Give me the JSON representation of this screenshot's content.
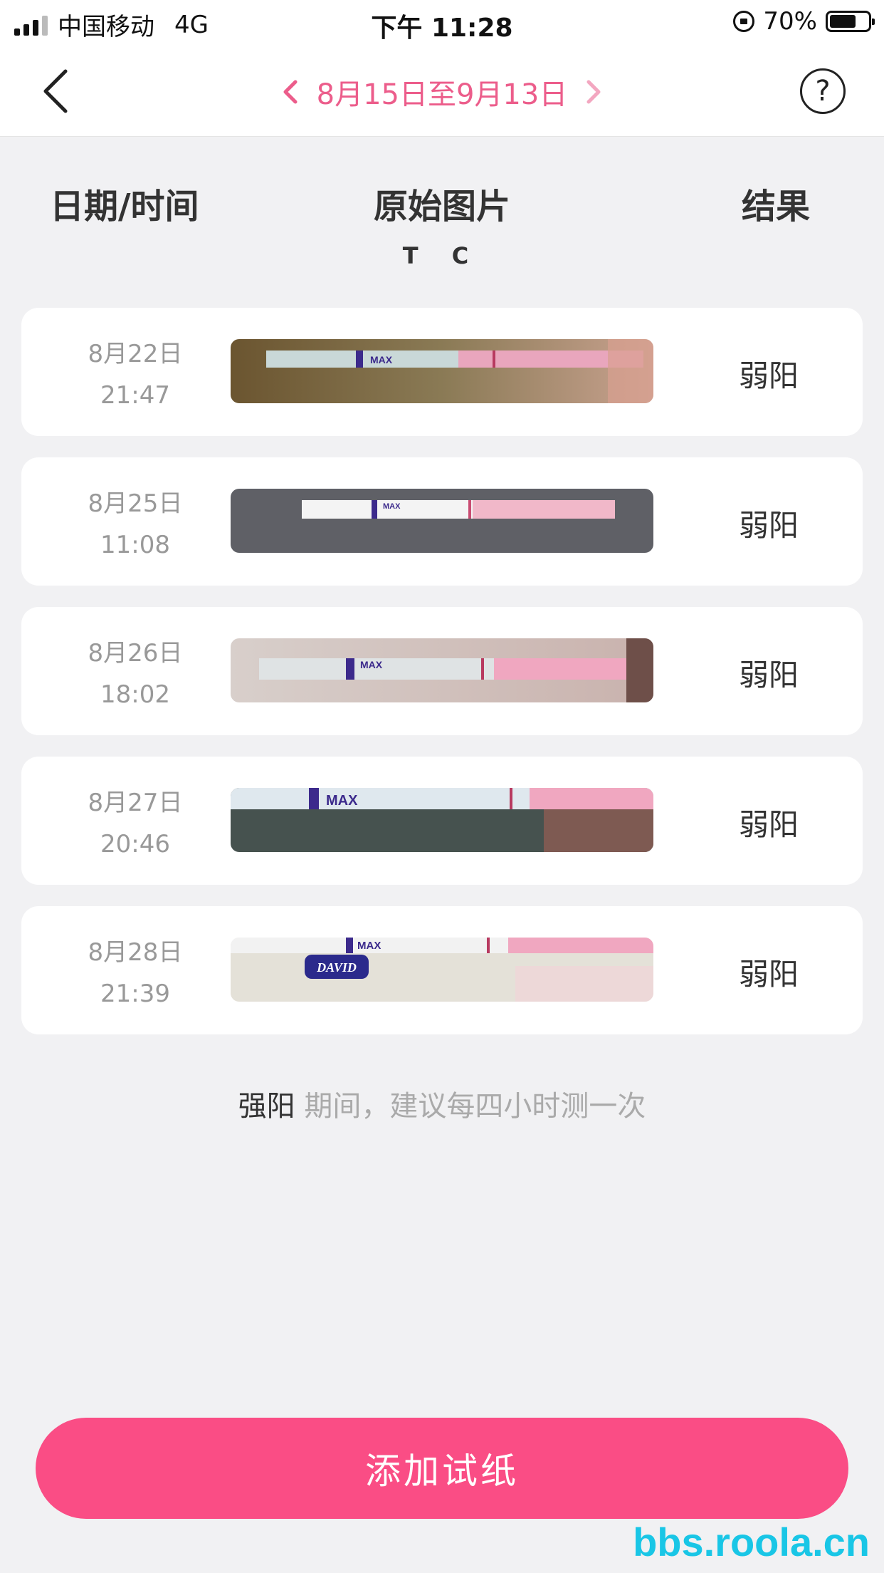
{
  "status_bar": {
    "carrier": "中国移动",
    "network": "4G",
    "time": "下午 11:28",
    "battery": "70%"
  },
  "nav": {
    "date_range": "8月15日至9月13日"
  },
  "columns": {
    "date_time": "日期/时间",
    "image": "原始图片",
    "result": "结果",
    "tc_marker": "T C"
  },
  "records": [
    {
      "date": "8月22日",
      "time": "21:47",
      "result": "弱阳",
      "max_label": "MAX"
    },
    {
      "date": "8月25日",
      "time": "11:08",
      "result": "弱阳",
      "max_label": "MAX"
    },
    {
      "date": "8月26日",
      "time": "18:02",
      "result": "弱阳",
      "max_label": "MAX"
    },
    {
      "date": "8月27日",
      "time": "20:46",
      "result": "弱阳",
      "max_label": "MAX"
    },
    {
      "date": "8月28日",
      "time": "21:39",
      "result": "弱阳",
      "max_label": "MAX",
      "brand": "DAVID"
    }
  ],
  "hint": {
    "strong": "强阳",
    "rest": " 期间，建议每四小时测一次"
  },
  "add_button": {
    "label": "添加试纸"
  },
  "watermark": "bbs.roola.cn",
  "colors": {
    "accent": "#fa4d85",
    "date_nav": "#ec5d8b"
  }
}
